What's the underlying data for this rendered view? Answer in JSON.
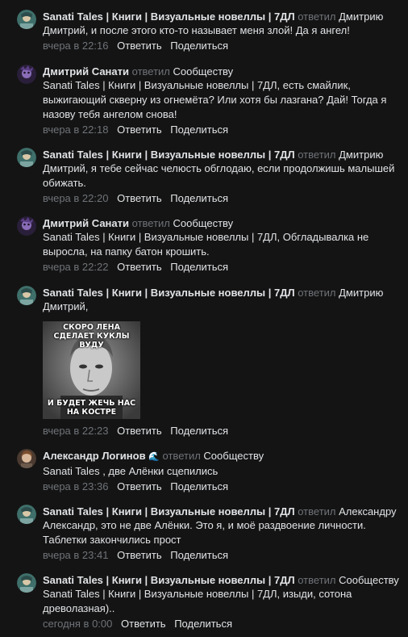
{
  "labels": {
    "replied": "ответил",
    "reply": "Ответить",
    "share": "Поделиться"
  },
  "comments": [
    {
      "author": "Sanati Tales | Книги | Визуальные новеллы | 7ДЛ",
      "target": "Дмитрию",
      "text": "Дмитрий, и после этого кто-то называет меня злой! Да я ангел!",
      "time": "вчера в 22:16",
      "avatar": "sanati-avatar"
    },
    {
      "author": "Дмитрий Санати",
      "target": "Сообществу",
      "text": "Sanati Tales | Книги | Визуальные новеллы | 7ДЛ, есть смайлик, выжигающий скверну из огнемёта? Или хотя бы лазгана? Дай! Тогда я назову тебя ангелом снова!",
      "time": "вчера в 22:18",
      "avatar": "dmitry-avatar"
    },
    {
      "author": "Sanati Tales | Книги | Визуальные новеллы | 7ДЛ",
      "target": "Дмитрию",
      "text": "Дмитрий, я тебе сейчас челюсть обглодаю, если продолжишь малышей обижать.",
      "time": "вчера в 22:20",
      "avatar": "sanati-avatar"
    },
    {
      "author": "Дмитрий Санати",
      "target": "Сообществу",
      "text": "Sanati Tales | Книги | Визуальные новеллы | 7ДЛ, Обгладывалка не выросла, на папку батон крошить.",
      "time": "вчера в 22:22",
      "avatar": "dmitry-avatar"
    },
    {
      "author": "Sanati Tales | Книги | Визуальные новеллы | 7ДЛ",
      "target": "Дмитрию",
      "text": "Дмитрий,",
      "meme_top": "СКОРО ЛЕНА СДЕЛАЕТ КУКЛЫ ВУДУ",
      "meme_bottom": "И БУДЕТ ЖЕЧЬ НАС НА КОСТРЕ",
      "time": "вчера в 22:23",
      "avatar": "sanati-avatar"
    },
    {
      "author": "Александр Логинов",
      "author_badge": "🌊",
      "target": "Сообществу",
      "text": "Sanati Tales , две Алёнки сцепились",
      "time": "вчера в 23:36",
      "avatar": "alexander-avatar"
    },
    {
      "author": "Sanati Tales | Книги | Визуальные новеллы | 7ДЛ",
      "target": "Александру",
      "text": "Александр, это не две Алёнки. Это я, и моё раздвоение личности. Таблетки закончились прост",
      "time": "вчера в 23:41",
      "avatar": "sanati-avatar"
    },
    {
      "author": "Sanati Tales | Книги | Визуальные новеллы | 7ДЛ",
      "target": "Сообществу",
      "text": "Sanati Tales | Книги | Визуальные новеллы | 7ДЛ, изыди, сотона древолазная)..",
      "time": "сегодня в 0:00",
      "avatar": "sanati-avatar"
    }
  ]
}
